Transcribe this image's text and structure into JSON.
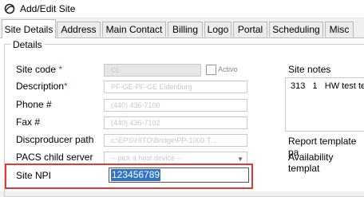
{
  "window": {
    "title": "Add/Edit Site"
  },
  "tabs": [
    {
      "label": "Site Details",
      "active": true
    },
    {
      "label": "Address"
    },
    {
      "label": "Main Contact"
    },
    {
      "label": "Billing"
    },
    {
      "label": "Logo"
    },
    {
      "label": "Portal"
    },
    {
      "label": "Scheduling"
    },
    {
      "label": "Misc"
    }
  ],
  "details": {
    "group_title": "Details",
    "site_code": {
      "label": "Site code",
      "required_mark": "*",
      "value": "CL"
    },
    "activo_label": "Activo",
    "description": {
      "label": "Description",
      "required_mark": "*",
      "value": "PF-GE-PF-GE Eldenburg"
    },
    "phone": {
      "label": "Phone #",
      "value": "(440) 436-7100"
    },
    "fax": {
      "label": "Fax #",
      "value": "(440) 436-7102"
    },
    "discproducer": {
      "label": "Discproducer path",
      "value": "c:\\EPS\\HITO\\Bridge\\PP-1000 T..."
    },
    "pacs_child": {
      "label": "PACS child server",
      "value": "-- pick a host device --"
    },
    "site_npi": {
      "label": "Site NPI",
      "value": "123456789"
    }
  },
  "right": {
    "notes_label": "Site notes",
    "notes_text": "313   1   HW test te",
    "report_template": "Report template pa",
    "availability_template": "Availability templat"
  },
  "colors": {
    "highlight_border": "#e03a33",
    "selection": "#3174c6"
  }
}
